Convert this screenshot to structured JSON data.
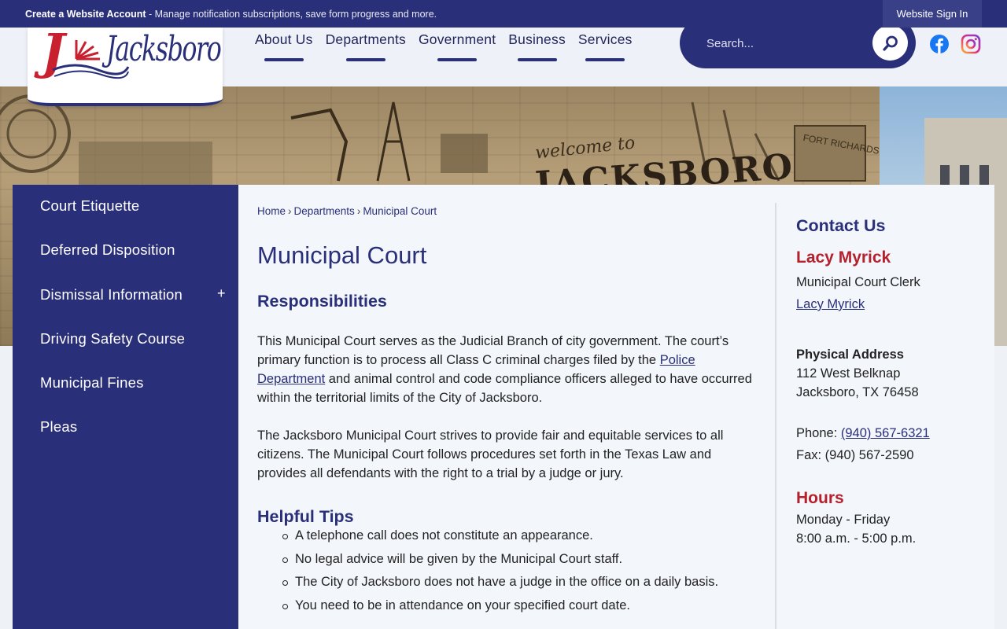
{
  "topbar": {
    "create_link": "Create a Website Account",
    "create_text": " - Manage notification subscriptions, save form progress and more.",
    "signin": "Website Sign In"
  },
  "logo": {
    "text": "Jacksboro"
  },
  "nav": {
    "items": [
      {
        "label": "About Us"
      },
      {
        "label": "Departments"
      },
      {
        "label": "Government"
      },
      {
        "label": "Business"
      },
      {
        "label": "Services"
      }
    ]
  },
  "search": {
    "placeholder": "Search..."
  },
  "hero": {
    "welcome": "welcome to",
    "town": "JACKSBORO",
    "fort": "FORT RICHARDSON"
  },
  "sidebar": {
    "items": [
      {
        "label": "Court Etiquette"
      },
      {
        "label": "Deferred Disposition"
      },
      {
        "label": "Dismissal Information",
        "toggle": "+"
      },
      {
        "label": "Driving Safety Course"
      },
      {
        "label": "Municipal Fines"
      },
      {
        "label": "Pleas"
      }
    ]
  },
  "breadcrumb": {
    "home": "Home",
    "sep": "›",
    "departments": "Departments",
    "current": "Municipal Court"
  },
  "main": {
    "title": "Municipal Court",
    "responsibilities_heading": "Responsibilities",
    "p1_a": "This Municipal Court serves as the Judicial Branch of city government. The court’s primary function is to process all Class C criminal charges filed by the ",
    "p1_link": "Police Department",
    "p1_b": " and animal control and code compliance officers alleged to have occurred within the territorial limits of the City of Jacksboro.",
    "p2": "The Jacksboro Municipal Court strives to provide fair and equitable services to all citizens. The Municipal Court follows procedures set forth in the Texas Law and provides all defendants with the right to a trial by a judge or jury.",
    "tips_heading": "Helpful Tips",
    "tips": [
      "A telephone call does not constitute an appearance.",
      "No legal advice will be given by the Municipal Court staff.",
      "The City of Jacksboro does not have a judge in the office on a daily basis.",
      "You need to be in attendance on your specified court date."
    ]
  },
  "contact": {
    "heading": "Contact Us",
    "name": "Lacy Myrick",
    "role": "Municipal Court Clerk",
    "email_link": "Lacy Myrick",
    "address_label": "Physical Address",
    "address_line1": "112 West Belknap",
    "address_line2": "Jacksboro, TX 76458",
    "phone_label": "Phone: ",
    "phone": "(940) 567-6321",
    "fax": "Fax: (940) 567-2590",
    "hours_heading": "Hours",
    "hours_days": "Monday - Friday",
    "hours_time": "8:00 a.m. - 5:00 p.m."
  },
  "colors": {
    "brand_navy": "#2a2f7a",
    "accent_red": "#b5202c"
  }
}
